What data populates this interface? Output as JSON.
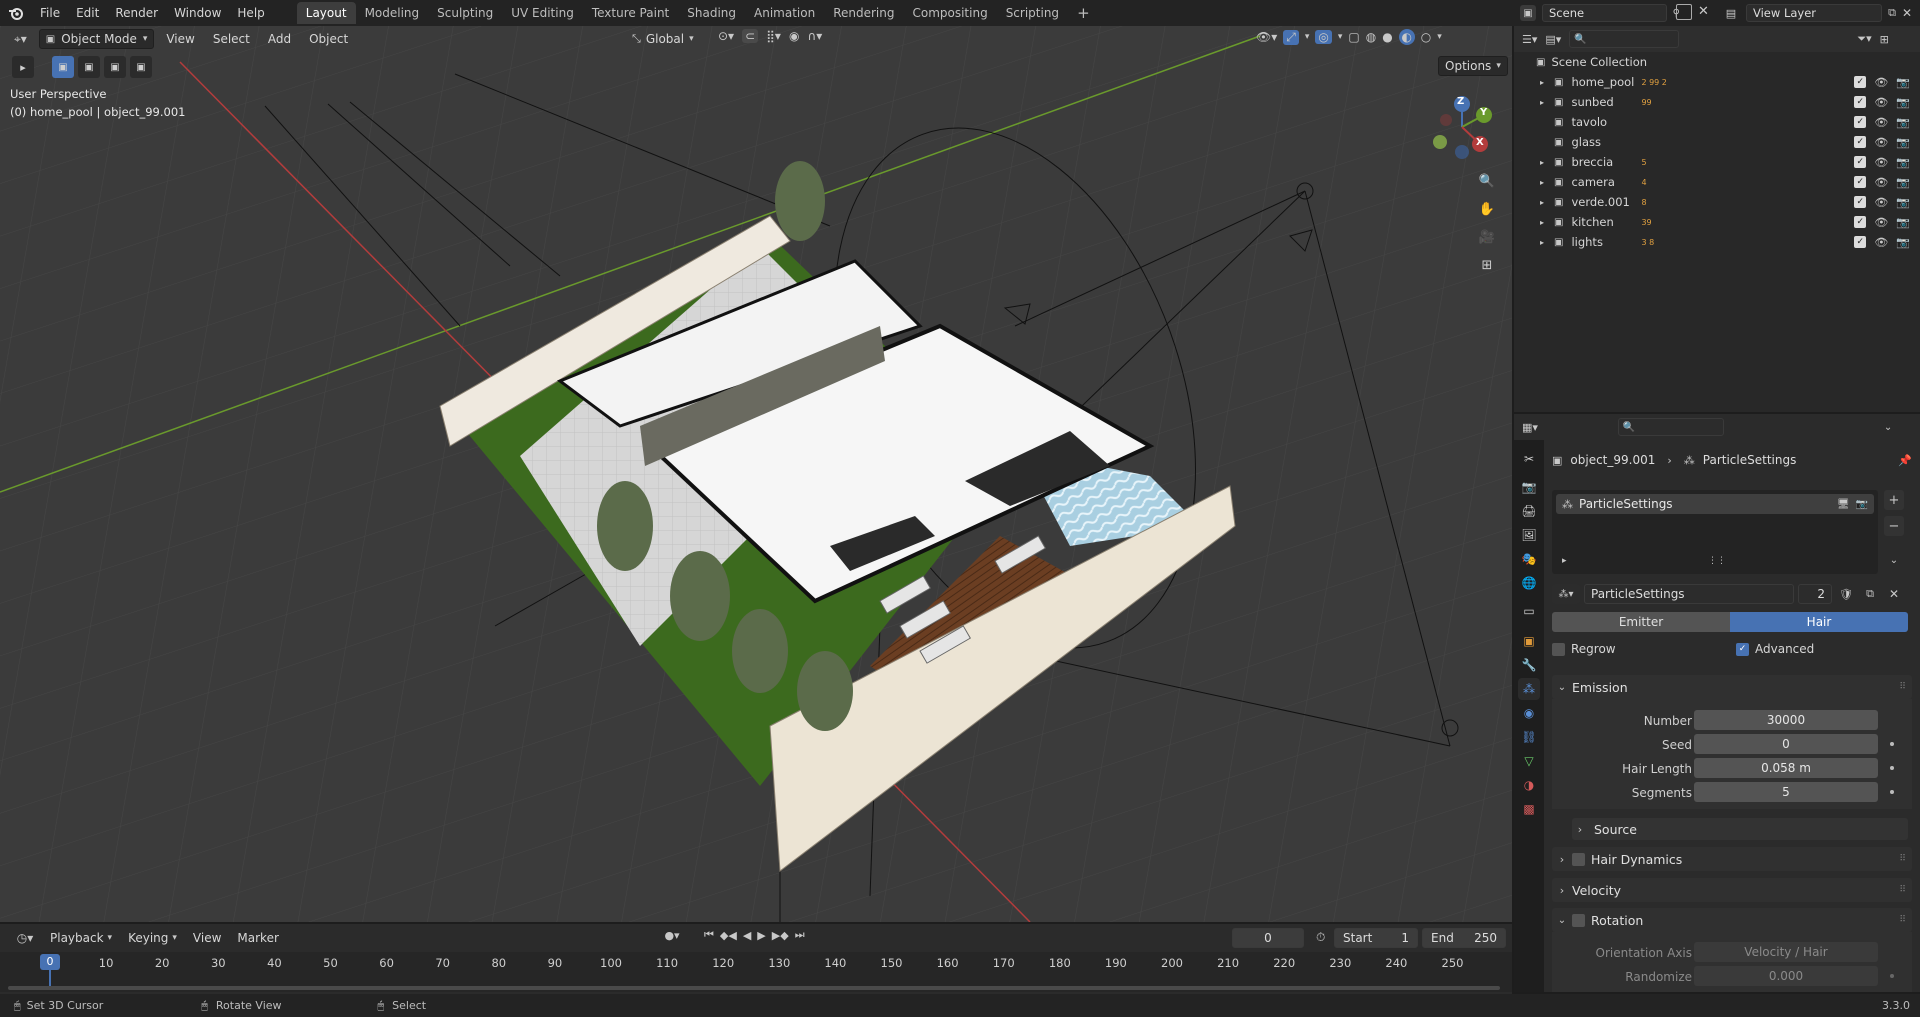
{
  "topbar": {
    "menus": [
      "File",
      "Edit",
      "Render",
      "Window",
      "Help"
    ],
    "workspaces": [
      "Layout",
      "Modeling",
      "Sculpting",
      "UV Editing",
      "Texture Paint",
      "Shading",
      "Animation",
      "Rendering",
      "Compositing",
      "Scripting"
    ],
    "active_workspace": "Layout",
    "add_tab": "+",
    "scene": "Scene",
    "view_layer": "View Layer"
  },
  "viewport": {
    "mode": "Object Mode",
    "menus": [
      "View",
      "Select",
      "Add",
      "Object"
    ],
    "orientation": "Global",
    "options_label": "Options",
    "overlay_title": "User Perspective",
    "overlay_subtitle": "(0) home_pool | object_99.001",
    "gizmo_axes": [
      "Z",
      "Y",
      "X"
    ]
  },
  "outliner": {
    "root": "Scene Collection",
    "items": [
      {
        "name": "home_pool",
        "badge": "2 99 2"
      },
      {
        "name": "sunbed",
        "badge": "99"
      },
      {
        "name": "tavolo",
        "badge": ""
      },
      {
        "name": "glass",
        "badge": ""
      },
      {
        "name": "breccia",
        "badge": "5"
      },
      {
        "name": "camera",
        "badge": "4"
      },
      {
        "name": "verde.001",
        "badge": "8"
      },
      {
        "name": "kitchen",
        "badge": "39"
      },
      {
        "name": "lights",
        "badge": "3 8"
      }
    ]
  },
  "properties": {
    "breadcrumb_object": "object_99.001",
    "breadcrumb_settings": "ParticleSettings",
    "list_item": "ParticleSettings",
    "datablock_name": "ParticleSettings",
    "datablock_users": "2",
    "type_emitter": "Emitter",
    "type_hair": "Hair",
    "regrow_label": "Regrow",
    "advanced_label": "Advanced",
    "emission": {
      "title": "Emission",
      "number_label": "Number",
      "number_value": "30000",
      "seed_label": "Seed",
      "seed_value": "0",
      "hair_length_label": "Hair Length",
      "hair_length_value": "0.058 m",
      "segments_label": "Segments",
      "segments_value": "5"
    },
    "source_label": "Source",
    "hair_dynamics_label": "Hair Dynamics",
    "velocity_label": "Velocity",
    "rotation": {
      "title": "Rotation",
      "orientation_label": "Orientation Axis",
      "orientation_value": "Velocity / Hair",
      "randomize_label": "Randomize",
      "randomize_value": "0.000"
    }
  },
  "timeline": {
    "menus": [
      "Playback",
      "Keying",
      "View",
      "Marker"
    ],
    "current_frame": "0",
    "start_label": "Start",
    "start_value": "1",
    "end_label": "End",
    "end_value": "250",
    "ticks": [
      "0",
      "10",
      "20",
      "30",
      "40",
      "50",
      "60",
      "70",
      "80",
      "90",
      "100",
      "110",
      "120",
      "130",
      "140",
      "150",
      "160",
      "170",
      "180",
      "190",
      "200",
      "210",
      "220",
      "230",
      "240",
      "250"
    ]
  },
  "statusbar": {
    "hint1": "Set 3D Cursor",
    "hint2": "Rotate View",
    "hint3": "Select",
    "version": "3.3.0"
  },
  "colors": {
    "accent_blue": "#4772b3",
    "axis_x": "#b33c3c",
    "axis_y": "#6a9a2c",
    "playhead": "#4772b3"
  }
}
